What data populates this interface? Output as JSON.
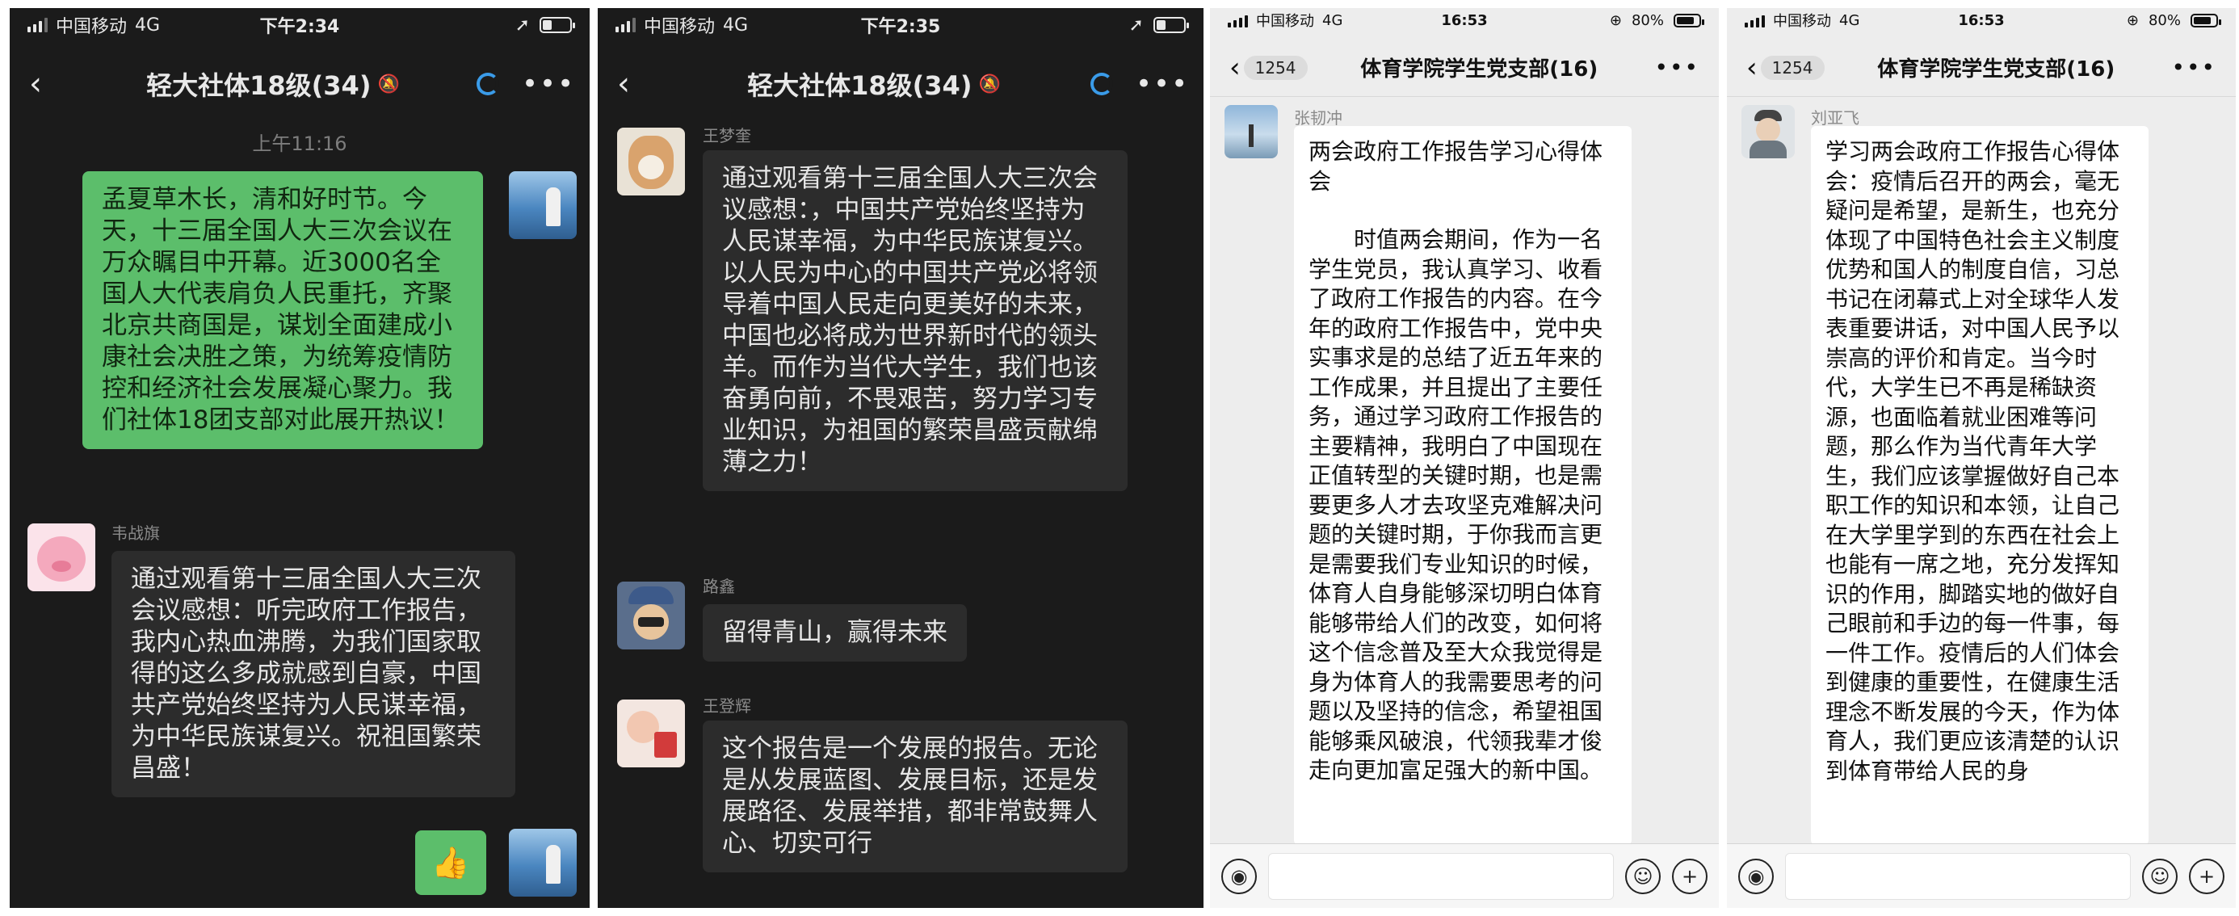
{
  "screens": [
    {
      "status": {
        "carrier": "中国移动",
        "network": "4G",
        "time": "下午2:34"
      },
      "title": "轻大社体18级(34)",
      "timestamp": "上午11:16",
      "messages": [
        {
          "sender": "",
          "text": "孟夏草木长，清和好时节。今天，十三届全国人大三次会议在万众瞩目中开幕。近3000名全国人大代表肩负人民重托，齐聚北京共商国是，谋划全面建成小康社会决胜之策，为统筹疫情防控和经济社会发展凝心聚力。我们社体18团支部对此展开热议！"
        },
        {
          "sender": "韦战旗",
          "text": "通过观看第十三届全国人大三次会议感想：听完政府工作报告，我内心热血沸腾，为我们国家取得的这么多成就感到自豪，中国共产党始终坚持为人民谋幸福，为中华民族谋复兴。祝祖国繁荣昌盛！"
        },
        {
          "sender": "",
          "text": "👍"
        }
      ]
    },
    {
      "status": {
        "carrier": "中国移动",
        "network": "4G",
        "time": "下午2:35"
      },
      "title": "轻大社体18级(34)",
      "messages": [
        {
          "sender": "王梦奎",
          "text": "通过观看第十三届全国人大三次会议感想：，中国共产党始终坚持为人民谋幸福，为中华民族谋复兴。以人民为中心的中国共产党必将领导着中国人民走向更美好的未来，中国也必将成为世界新时代的领头羊。而作为当代大学生，我们也该奋勇向前，不畏艰苦，努力学习专业知识，为祖国的繁荣昌盛贡献绵薄之力！"
        },
        {
          "sender": "路鑫",
          "text": "留得青山，赢得未来"
        },
        {
          "sender": "王登辉",
          "text": "这个报告是一个发展的报告。无论是从发展蓝图、发展目标，还是发展路径、发展举措，都非常鼓舞人心、切实可行"
        }
      ]
    },
    {
      "status": {
        "carrier": "中国移动",
        "network": "4G",
        "time": "16:53",
        "battery": "80%"
      },
      "title": "体育学院学生党支部(16)",
      "unread": "1254",
      "messages": [
        {
          "sender": "张韧冲",
          "heading": "两会政府工作报告学习心得体会",
          "text": "时值两会期间，作为一名学生党员，我认真学习、收看了政府工作报告的内容。在今年的政府工作报告中，党中央实事求是的总结了近五年来的工作成果，并且提出了主要任务，通过学习政府工作报告的主要精神，我明白了中国现在正值转型的关键时期，也是需要更多人才去攻坚克难解决问题的关键时期，于你我而言更是需要我们专业知识的时候，体育人自身能够深切明白体育能够带给人们的改变，如何将这个信念普及至大众我觉得是身为体育人的我需要思考的问题以及坚持的信念，希望祖国能够乘风破浪，代领我辈才俊走向更加富足强大的新中国。"
        }
      ]
    },
    {
      "status": {
        "carrier": "中国移动",
        "network": "4G",
        "time": "16:53",
        "battery": "80%"
      },
      "title": "体育学院学生党支部(16)",
      "unread": "1254",
      "messages": [
        {
          "sender": "刘亚飞",
          "text": "学习两会政府工作报告心得体会：疫情后召开的两会，毫无疑问是希望，是新生，也充分体现了中国特色社会主义制度优势和国人的制度自信，习总书记在闭幕式上对全球华人发表重要讲话，对中国人民予以崇高的评价和肯定。当今时代，大学生已不再是稀缺资源，也面临着就业困难等问题，那么作为当代青年大学生，我们应该掌握做好自己本职工作的知识和本领，让自己在大学里学到的东西在社会上也能有一席之地，充分发挥知识的作用，脚踏实地的做好自己眼前和手边的每一件事，每一件工作。疫情后的人们体会到健康的重要性，在健康生活理念不断发展的今天，作为体育人，我们更应该清楚的认识到体育带给人民的身"
        }
      ]
    }
  ],
  "colors": {
    "dark_bg": "#1b1b1b",
    "bubble_dark": "#2c2c2c",
    "bubble_green": "#5cbe6b",
    "accent_blue": "#3a9be8",
    "light_bg": "#ededed"
  },
  "icons": [
    "back-icon",
    "more-icon",
    "mute-icon",
    "sync-icon",
    "voice-icon",
    "emoji-icon",
    "plus-icon",
    "signal-icon",
    "battery-icon",
    "location-icon",
    "orientation-lock-icon"
  ]
}
